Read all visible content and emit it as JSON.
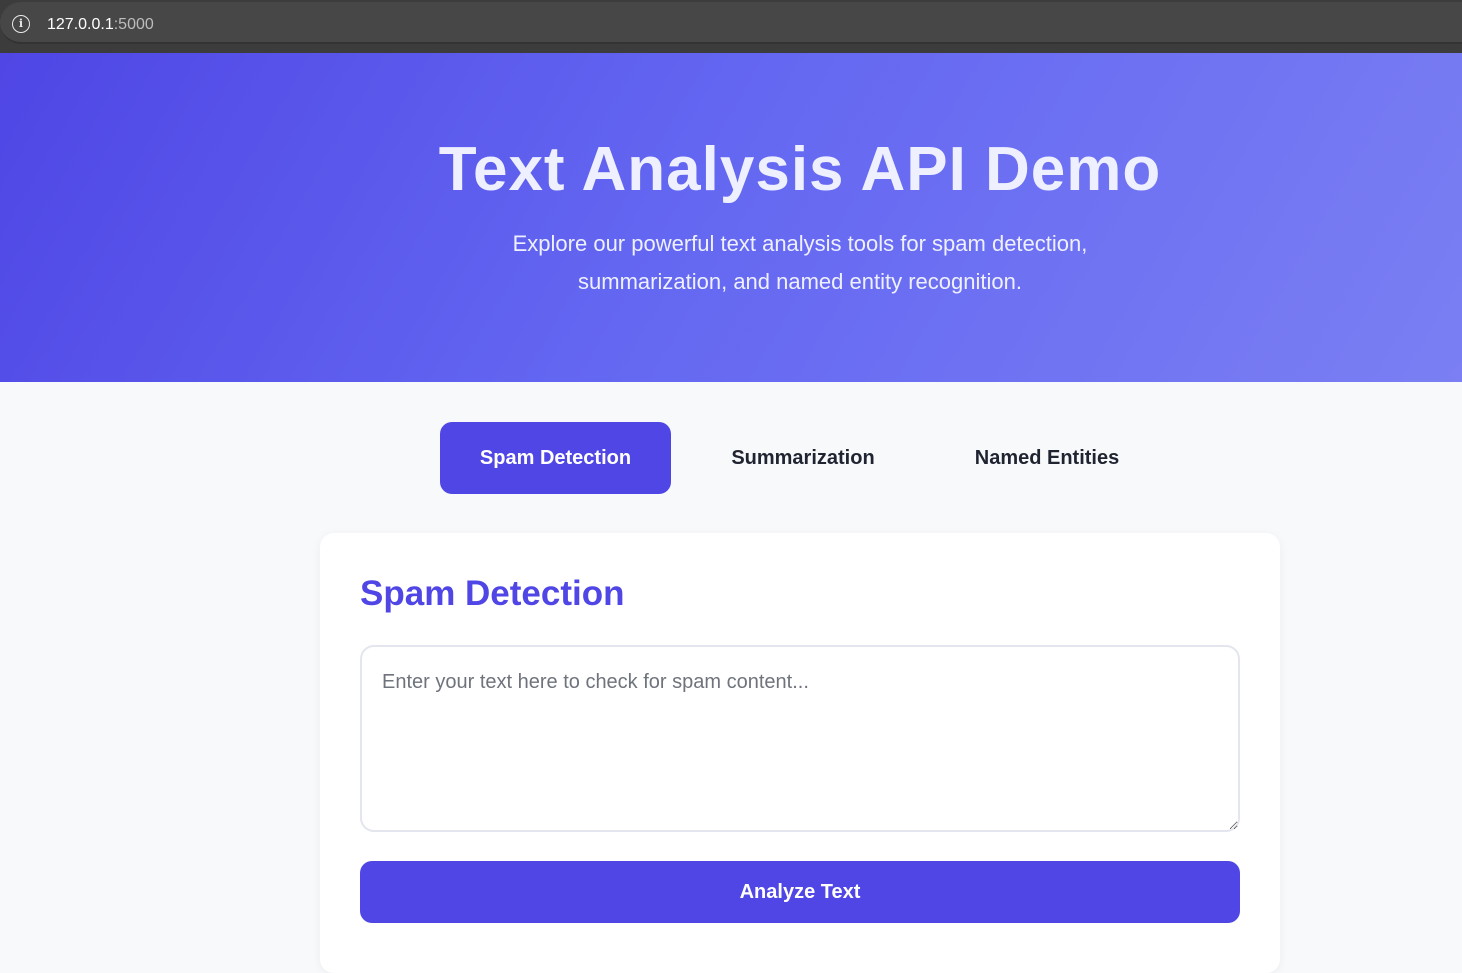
{
  "browser": {
    "url_host": "127.0.0.1",
    "url_port": ":5000",
    "info_icon": "info-icon"
  },
  "hero": {
    "title": "Text Analysis API Demo",
    "subtitle": "Explore our powerful text analysis tools for spam detection, summarization, and named entity recognition."
  },
  "tabs": [
    {
      "label": "Spam Detection",
      "active": true
    },
    {
      "label": "Summarization",
      "active": false
    },
    {
      "label": "Named Entities",
      "active": false
    }
  ],
  "panel": {
    "title": "Spam Detection",
    "input_value": "",
    "input_placeholder": "Enter your text here to check for spam content...",
    "submit_label": "Analyze Text"
  },
  "colors": {
    "accent": "#4f46e5",
    "hero_gradient_start": "#4f46e5",
    "hero_gradient_end": "#7b7ff3",
    "page_background": "#f8f9fb"
  }
}
